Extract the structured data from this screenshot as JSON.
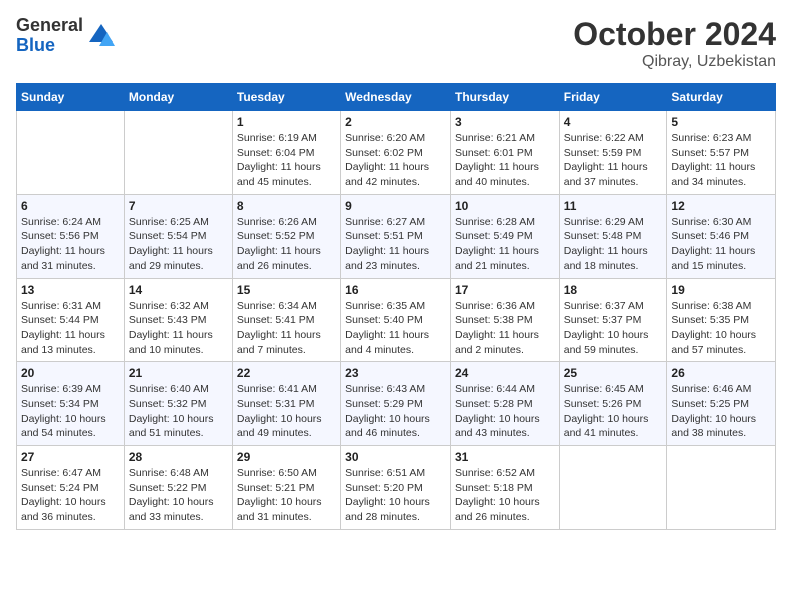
{
  "logo": {
    "general": "General",
    "blue": "Blue"
  },
  "header": {
    "month": "October 2024",
    "location": "Qibray, Uzbekistan"
  },
  "days_of_week": [
    "Sunday",
    "Monday",
    "Tuesday",
    "Wednesday",
    "Thursday",
    "Friday",
    "Saturday"
  ],
  "weeks": [
    [
      {
        "day": "",
        "sunrise": "",
        "sunset": "",
        "daylight": ""
      },
      {
        "day": "",
        "sunrise": "",
        "sunset": "",
        "daylight": ""
      },
      {
        "day": "1",
        "sunrise": "Sunrise: 6:19 AM",
        "sunset": "Sunset: 6:04 PM",
        "daylight": "Daylight: 11 hours and 45 minutes."
      },
      {
        "day": "2",
        "sunrise": "Sunrise: 6:20 AM",
        "sunset": "Sunset: 6:02 PM",
        "daylight": "Daylight: 11 hours and 42 minutes."
      },
      {
        "day": "3",
        "sunrise": "Sunrise: 6:21 AM",
        "sunset": "Sunset: 6:01 PM",
        "daylight": "Daylight: 11 hours and 40 minutes."
      },
      {
        "day": "4",
        "sunrise": "Sunrise: 6:22 AM",
        "sunset": "Sunset: 5:59 PM",
        "daylight": "Daylight: 11 hours and 37 minutes."
      },
      {
        "day": "5",
        "sunrise": "Sunrise: 6:23 AM",
        "sunset": "Sunset: 5:57 PM",
        "daylight": "Daylight: 11 hours and 34 minutes."
      }
    ],
    [
      {
        "day": "6",
        "sunrise": "Sunrise: 6:24 AM",
        "sunset": "Sunset: 5:56 PM",
        "daylight": "Daylight: 11 hours and 31 minutes."
      },
      {
        "day": "7",
        "sunrise": "Sunrise: 6:25 AM",
        "sunset": "Sunset: 5:54 PM",
        "daylight": "Daylight: 11 hours and 29 minutes."
      },
      {
        "day": "8",
        "sunrise": "Sunrise: 6:26 AM",
        "sunset": "Sunset: 5:52 PM",
        "daylight": "Daylight: 11 hours and 26 minutes."
      },
      {
        "day": "9",
        "sunrise": "Sunrise: 6:27 AM",
        "sunset": "Sunset: 5:51 PM",
        "daylight": "Daylight: 11 hours and 23 minutes."
      },
      {
        "day": "10",
        "sunrise": "Sunrise: 6:28 AM",
        "sunset": "Sunset: 5:49 PM",
        "daylight": "Daylight: 11 hours and 21 minutes."
      },
      {
        "day": "11",
        "sunrise": "Sunrise: 6:29 AM",
        "sunset": "Sunset: 5:48 PM",
        "daylight": "Daylight: 11 hours and 18 minutes."
      },
      {
        "day": "12",
        "sunrise": "Sunrise: 6:30 AM",
        "sunset": "Sunset: 5:46 PM",
        "daylight": "Daylight: 11 hours and 15 minutes."
      }
    ],
    [
      {
        "day": "13",
        "sunrise": "Sunrise: 6:31 AM",
        "sunset": "Sunset: 5:44 PM",
        "daylight": "Daylight: 11 hours and 13 minutes."
      },
      {
        "day": "14",
        "sunrise": "Sunrise: 6:32 AM",
        "sunset": "Sunset: 5:43 PM",
        "daylight": "Daylight: 11 hours and 10 minutes."
      },
      {
        "day": "15",
        "sunrise": "Sunrise: 6:34 AM",
        "sunset": "Sunset: 5:41 PM",
        "daylight": "Daylight: 11 hours and 7 minutes."
      },
      {
        "day": "16",
        "sunrise": "Sunrise: 6:35 AM",
        "sunset": "Sunset: 5:40 PM",
        "daylight": "Daylight: 11 hours and 4 minutes."
      },
      {
        "day": "17",
        "sunrise": "Sunrise: 6:36 AM",
        "sunset": "Sunset: 5:38 PM",
        "daylight": "Daylight: 11 hours and 2 minutes."
      },
      {
        "day": "18",
        "sunrise": "Sunrise: 6:37 AM",
        "sunset": "Sunset: 5:37 PM",
        "daylight": "Daylight: 10 hours and 59 minutes."
      },
      {
        "day": "19",
        "sunrise": "Sunrise: 6:38 AM",
        "sunset": "Sunset: 5:35 PM",
        "daylight": "Daylight: 10 hours and 57 minutes."
      }
    ],
    [
      {
        "day": "20",
        "sunrise": "Sunrise: 6:39 AM",
        "sunset": "Sunset: 5:34 PM",
        "daylight": "Daylight: 10 hours and 54 minutes."
      },
      {
        "day": "21",
        "sunrise": "Sunrise: 6:40 AM",
        "sunset": "Sunset: 5:32 PM",
        "daylight": "Daylight: 10 hours and 51 minutes."
      },
      {
        "day": "22",
        "sunrise": "Sunrise: 6:41 AM",
        "sunset": "Sunset: 5:31 PM",
        "daylight": "Daylight: 10 hours and 49 minutes."
      },
      {
        "day": "23",
        "sunrise": "Sunrise: 6:43 AM",
        "sunset": "Sunset: 5:29 PM",
        "daylight": "Daylight: 10 hours and 46 minutes."
      },
      {
        "day": "24",
        "sunrise": "Sunrise: 6:44 AM",
        "sunset": "Sunset: 5:28 PM",
        "daylight": "Daylight: 10 hours and 43 minutes."
      },
      {
        "day": "25",
        "sunrise": "Sunrise: 6:45 AM",
        "sunset": "Sunset: 5:26 PM",
        "daylight": "Daylight: 10 hours and 41 minutes."
      },
      {
        "day": "26",
        "sunrise": "Sunrise: 6:46 AM",
        "sunset": "Sunset: 5:25 PM",
        "daylight": "Daylight: 10 hours and 38 minutes."
      }
    ],
    [
      {
        "day": "27",
        "sunrise": "Sunrise: 6:47 AM",
        "sunset": "Sunset: 5:24 PM",
        "daylight": "Daylight: 10 hours and 36 minutes."
      },
      {
        "day": "28",
        "sunrise": "Sunrise: 6:48 AM",
        "sunset": "Sunset: 5:22 PM",
        "daylight": "Daylight: 10 hours and 33 minutes."
      },
      {
        "day": "29",
        "sunrise": "Sunrise: 6:50 AM",
        "sunset": "Sunset: 5:21 PM",
        "daylight": "Daylight: 10 hours and 31 minutes."
      },
      {
        "day": "30",
        "sunrise": "Sunrise: 6:51 AM",
        "sunset": "Sunset: 5:20 PM",
        "daylight": "Daylight: 10 hours and 28 minutes."
      },
      {
        "day": "31",
        "sunrise": "Sunrise: 6:52 AM",
        "sunset": "Sunset: 5:18 PM",
        "daylight": "Daylight: 10 hours and 26 minutes."
      },
      {
        "day": "",
        "sunrise": "",
        "sunset": "",
        "daylight": ""
      },
      {
        "day": "",
        "sunrise": "",
        "sunset": "",
        "daylight": ""
      }
    ]
  ]
}
